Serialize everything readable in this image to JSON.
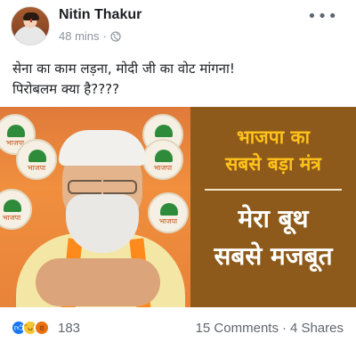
{
  "post": {
    "author": "Nitin Thakur",
    "time": "48 mins",
    "separator": "·",
    "text_line1": "सेना का काम लड़ना, मोदी जी का वोट मांगना!",
    "text_line2": "पिरोबलम क्या है????",
    "more_icon": "more-options-icon",
    "privacy_icon": "globe-icon"
  },
  "image": {
    "panel_line1": "भाजपा का",
    "panel_line2": "सबसे बड़ा मंत्र",
    "panel_line3": "मेरा बूथ",
    "panel_line4": "सबसे मजबूत",
    "emblem_label": "भाजपा"
  },
  "footer": {
    "reaction_icons": [
      "like-icon",
      "haha-icon",
      "angry-icon"
    ],
    "reaction_count": "183",
    "comments": "15 Comments",
    "dot": "·",
    "shares": "4 Shares"
  },
  "colors": {
    "panel_bg": "#8d5a1b",
    "panel_accent": "#ffc21a",
    "like_blue": "#1877f2",
    "meta_gray": "#8d949e"
  }
}
